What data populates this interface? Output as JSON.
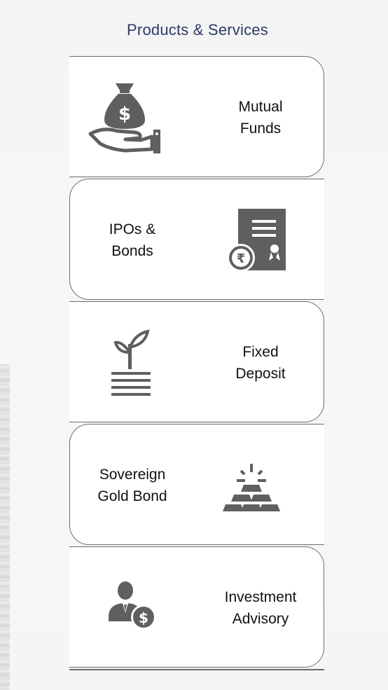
{
  "page": {
    "title": "Products & Services"
  },
  "colors": {
    "title": "#2b3a67",
    "icon": "#5f5f5f",
    "border": "#6b6b6b"
  },
  "cards": [
    {
      "label_line1": "Mutual",
      "label_line2": "Funds",
      "icon": "money-bag-hand-icon"
    },
    {
      "label_line1": "IPOs &",
      "label_line2": "Bonds",
      "icon": "certificate-rupee-icon"
    },
    {
      "label_line1": "Fixed",
      "label_line2": "Deposit",
      "icon": "plant-growth-icon"
    },
    {
      "label_line1": "Sovereign",
      "label_line2": "Gold Bond",
      "icon": "gold-bars-icon"
    },
    {
      "label_line1": "Investment",
      "label_line2": "Advisory",
      "icon": "advisor-dollar-icon"
    }
  ]
}
